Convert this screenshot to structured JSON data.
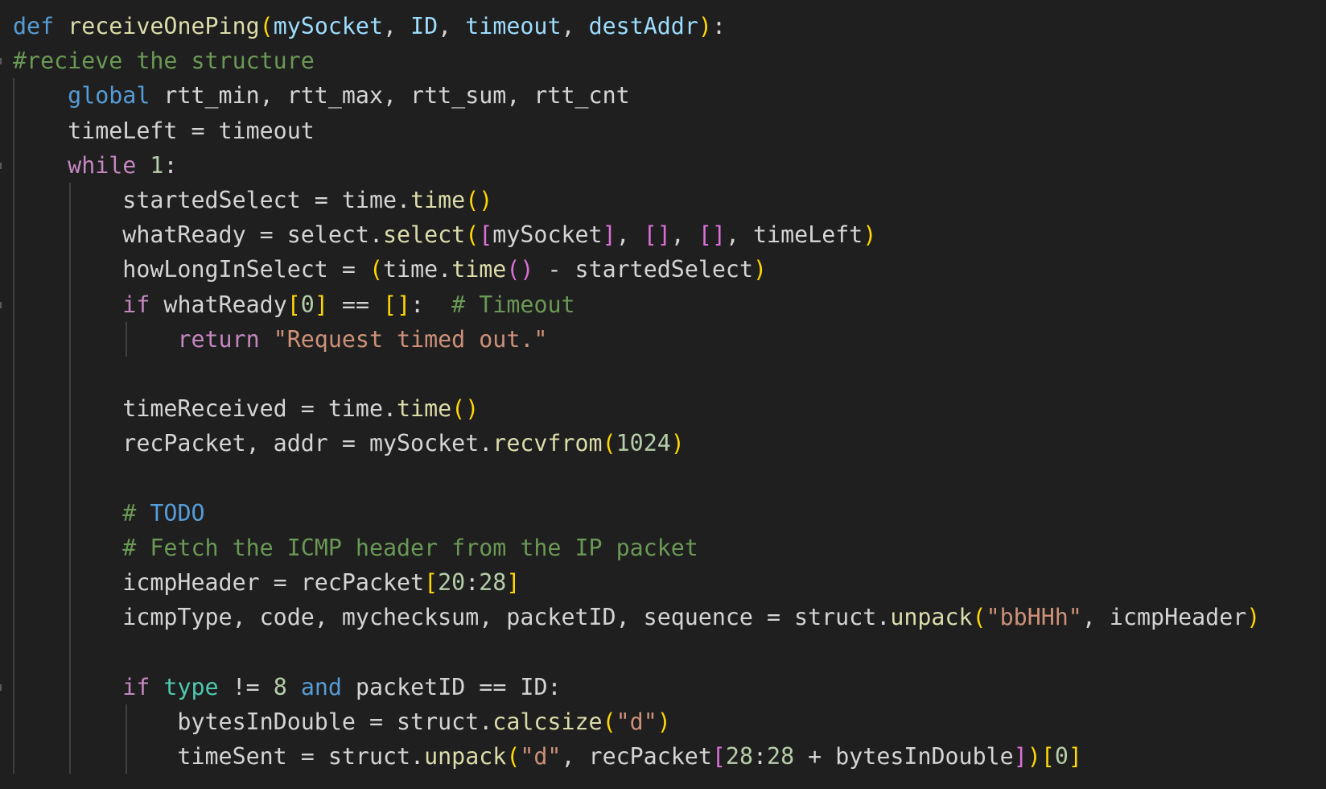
{
  "editor": {
    "lines": [
      {
        "tokens": [
          {
            "t": "def",
            "c": "kw"
          },
          {
            "t": " ",
            "c": "vr"
          },
          {
            "t": "receiveOnePing",
            "c": "fn"
          },
          {
            "t": "(",
            "c": "b1"
          },
          {
            "t": "mySocket",
            "c": "pa"
          },
          {
            "t": ", ",
            "c": "vr"
          },
          {
            "t": "ID",
            "c": "pa"
          },
          {
            "t": ", ",
            "c": "vr"
          },
          {
            "t": "timeout",
            "c": "pa"
          },
          {
            "t": ", ",
            "c": "vr"
          },
          {
            "t": "destAddr",
            "c": "pa"
          },
          {
            "t": ")",
            "c": "b1"
          },
          {
            "t": ":",
            "c": "vr"
          }
        ]
      },
      {
        "tokens": [
          {
            "t": "#recieve the structure",
            "c": "cm"
          }
        ]
      },
      {
        "tokens": [
          {
            "t": "    ",
            "c": "vr"
          },
          {
            "t": "global",
            "c": "kw"
          },
          {
            "t": " rtt_min, rtt_max, rtt_sum, rtt_cnt",
            "c": "vr"
          }
        ]
      },
      {
        "tokens": [
          {
            "t": "    timeLeft = timeout",
            "c": "vr"
          }
        ]
      },
      {
        "tokens": [
          {
            "t": "    ",
            "c": "vr"
          },
          {
            "t": "while",
            "c": "kc"
          },
          {
            "t": " ",
            "c": "vr"
          },
          {
            "t": "1",
            "c": "nm"
          },
          {
            "t": ":",
            "c": "vr"
          }
        ]
      },
      {
        "tokens": [
          {
            "t": "        startedSelect = time.",
            "c": "vr"
          },
          {
            "t": "time",
            "c": "fn"
          },
          {
            "t": "()",
            "c": "b1"
          }
        ]
      },
      {
        "tokens": [
          {
            "t": "        whatReady = select.",
            "c": "vr"
          },
          {
            "t": "select",
            "c": "fn"
          },
          {
            "t": "(",
            "c": "b1"
          },
          {
            "t": "[",
            "c": "b2"
          },
          {
            "t": "mySocket",
            "c": "vr"
          },
          {
            "t": "]",
            "c": "b2"
          },
          {
            "t": ", ",
            "c": "vr"
          },
          {
            "t": "[]",
            "c": "b2"
          },
          {
            "t": ", ",
            "c": "vr"
          },
          {
            "t": "[]",
            "c": "b2"
          },
          {
            "t": ", timeLeft",
            "c": "vr"
          },
          {
            "t": ")",
            "c": "b1"
          }
        ]
      },
      {
        "tokens": [
          {
            "t": "        howLongInSelect = ",
            "c": "vr"
          },
          {
            "t": "(",
            "c": "b1"
          },
          {
            "t": "time.",
            "c": "vr"
          },
          {
            "t": "time",
            "c": "fn"
          },
          {
            "t": "()",
            "c": "b2"
          },
          {
            "t": " - startedSelect",
            "c": "vr"
          },
          {
            "t": ")",
            "c": "b1"
          }
        ]
      },
      {
        "tokens": [
          {
            "t": "        ",
            "c": "vr"
          },
          {
            "t": "if",
            "c": "kc"
          },
          {
            "t": " whatReady",
            "c": "vr"
          },
          {
            "t": "[",
            "c": "b1"
          },
          {
            "t": "0",
            "c": "nm"
          },
          {
            "t": "]",
            "c": "b1"
          },
          {
            "t": " == ",
            "c": "vr"
          },
          {
            "t": "[]",
            "c": "b1"
          },
          {
            "t": ":  ",
            "c": "vr"
          },
          {
            "t": "# Timeout",
            "c": "cm"
          }
        ]
      },
      {
        "tokens": [
          {
            "t": "            ",
            "c": "vr"
          },
          {
            "t": "return",
            "c": "kc"
          },
          {
            "t": " ",
            "c": "vr"
          },
          {
            "t": "\"Request timed out.\"",
            "c": "st"
          }
        ]
      },
      {
        "tokens": []
      },
      {
        "tokens": [
          {
            "t": "        timeReceived = time.",
            "c": "vr"
          },
          {
            "t": "time",
            "c": "fn"
          },
          {
            "t": "()",
            "c": "b1"
          }
        ]
      },
      {
        "tokens": [
          {
            "t": "        recPacket, addr = mySocket.",
            "c": "vr"
          },
          {
            "t": "recvfrom",
            "c": "fn"
          },
          {
            "t": "(",
            "c": "b1"
          },
          {
            "t": "1024",
            "c": "nm"
          },
          {
            "t": ")",
            "c": "b1"
          }
        ]
      },
      {
        "tokens": []
      },
      {
        "tokens": [
          {
            "t": "        ",
            "c": "vr"
          },
          {
            "t": "# ",
            "c": "cm"
          },
          {
            "t": "TODO",
            "c": "todo"
          }
        ]
      },
      {
        "tokens": [
          {
            "t": "        ",
            "c": "vr"
          },
          {
            "t": "# Fetch the ICMP header from the IP packet",
            "c": "cm"
          }
        ]
      },
      {
        "tokens": [
          {
            "t": "        icmpHeader = recPacket",
            "c": "vr"
          },
          {
            "t": "[",
            "c": "b1"
          },
          {
            "t": "20",
            "c": "nm"
          },
          {
            "t": ":",
            "c": "vr"
          },
          {
            "t": "28",
            "c": "nm"
          },
          {
            "t": "]",
            "c": "b1"
          }
        ]
      },
      {
        "tokens": [
          {
            "t": "        icmpType, code, mychecksum, packetID, sequence = struct.",
            "c": "vr"
          },
          {
            "t": "unpack",
            "c": "fn"
          },
          {
            "t": "(",
            "c": "b1"
          },
          {
            "t": "\"bbHHh\"",
            "c": "st"
          },
          {
            "t": ", icmpHeader",
            "c": "vr"
          },
          {
            "t": ")",
            "c": "b1"
          }
        ]
      },
      {
        "tokens": []
      },
      {
        "tokens": [
          {
            "t": "        ",
            "c": "vr"
          },
          {
            "t": "if",
            "c": "kc"
          },
          {
            "t": " ",
            "c": "vr"
          },
          {
            "t": "type",
            "c": "bi"
          },
          {
            "t": " != ",
            "c": "vr"
          },
          {
            "t": "8",
            "c": "nm"
          },
          {
            "t": " ",
            "c": "vr"
          },
          {
            "t": "and",
            "c": "kw"
          },
          {
            "t": " packetID == ID:",
            "c": "vr"
          }
        ]
      },
      {
        "tokens": [
          {
            "t": "            bytesInDouble = struct.",
            "c": "vr"
          },
          {
            "t": "calcsize",
            "c": "fn"
          },
          {
            "t": "(",
            "c": "b1"
          },
          {
            "t": "\"d\"",
            "c": "st"
          },
          {
            "t": ")",
            "c": "b1"
          }
        ]
      },
      {
        "tokens": [
          {
            "t": "            timeSent = struct.",
            "c": "vr"
          },
          {
            "t": "unpack",
            "c": "fn"
          },
          {
            "t": "(",
            "c": "b1"
          },
          {
            "t": "\"d\"",
            "c": "st"
          },
          {
            "t": ", recPacket",
            "c": "vr"
          },
          {
            "t": "[",
            "c": "b2"
          },
          {
            "t": "28",
            "c": "nm"
          },
          {
            "t": ":",
            "c": "vr"
          },
          {
            "t": "28",
            "c": "nm"
          },
          {
            "t": " + bytesInDouble",
            "c": "vr"
          },
          {
            "t": "]",
            "c": "b2"
          },
          {
            "t": ")",
            "c": "b1"
          },
          {
            "t": "[",
            "c": "b1"
          },
          {
            "t": "0",
            "c": "nm"
          },
          {
            "t": "]",
            "c": "b1"
          }
        ]
      }
    ],
    "guides": [
      [],
      [],
      [
        "g1"
      ],
      [
        "g1"
      ],
      [
        "g1"
      ],
      [
        "g1",
        "g2"
      ],
      [
        "g1",
        "g2"
      ],
      [
        "g1",
        "g2"
      ],
      [
        "g1",
        "g2"
      ],
      [
        "g1",
        "g2",
        "g3"
      ],
      [
        "g1",
        "g2"
      ],
      [
        "g1",
        "g2"
      ],
      [
        "g1",
        "g2"
      ],
      [
        "g1",
        "g2"
      ],
      [
        "g1",
        "g2"
      ],
      [
        "g1",
        "g2"
      ],
      [
        "g1",
        "g2"
      ],
      [
        "g1",
        "g2"
      ],
      [
        "g1",
        "g2"
      ],
      [
        "g1",
        "g2"
      ],
      [
        "g1",
        "g2",
        "g3"
      ],
      [
        "g1",
        "g2",
        "g3"
      ]
    ],
    "folds": [
      1,
      4,
      8,
      19
    ]
  }
}
